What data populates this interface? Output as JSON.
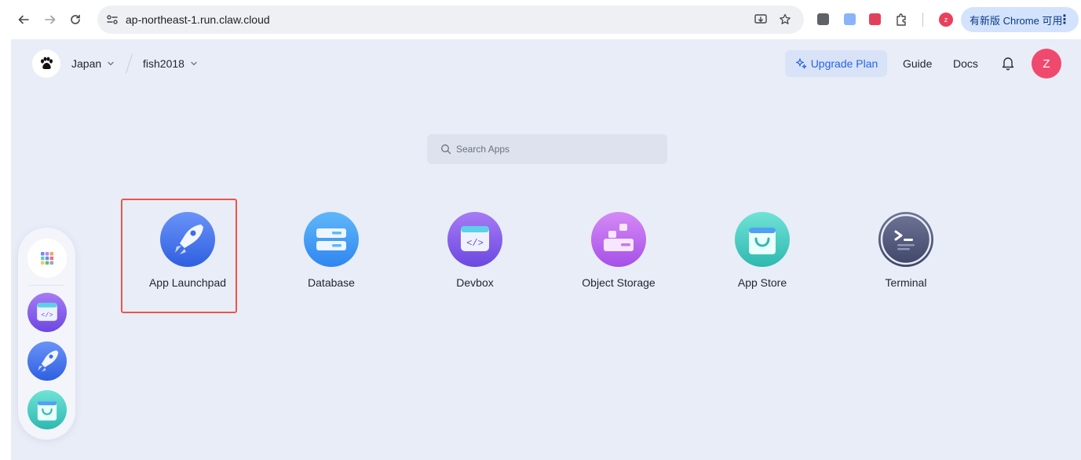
{
  "browser": {
    "url": "ap-northeast-1.run.claw.cloud",
    "profile_initial": "z",
    "update_label": "有新版 Chrome 可用"
  },
  "header": {
    "region": "Japan",
    "workspace": "fish2018",
    "upgrade_label": "Upgrade Plan",
    "guide_label": "Guide",
    "docs_label": "Docs",
    "avatar_initial": "Z"
  },
  "search": {
    "placeholder": "Search Apps"
  },
  "apps": [
    {
      "label": "App Launchpad",
      "icon": "rocket-icon"
    },
    {
      "label": "Database",
      "icon": "database-icon"
    },
    {
      "label": "Devbox",
      "icon": "devbox-icon"
    },
    {
      "label": "Object Storage",
      "icon": "object-storage-icon"
    },
    {
      "label": "App Store",
      "icon": "app-store-icon"
    },
    {
      "label": "Terminal",
      "icon": "terminal-icon"
    }
  ],
  "dock": [
    "apps-grid-icon",
    "devbox-icon",
    "rocket-icon",
    "app-store-icon"
  ],
  "colors": {
    "page_bg": "#e9edf8",
    "accent": "#2563eb",
    "highlight": "#e8584a",
    "avatar": "#ef4a6e"
  }
}
